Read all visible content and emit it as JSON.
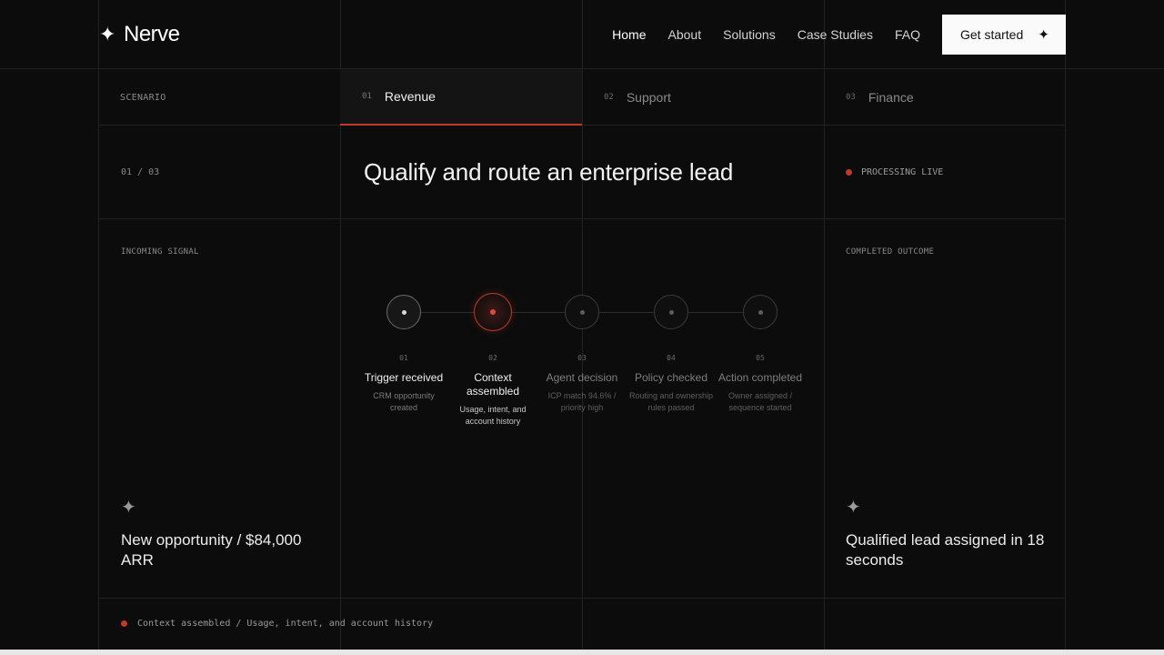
{
  "brand": {
    "name": "Nerve",
    "icon": "sparkle-icon"
  },
  "nav": {
    "items": [
      {
        "label": "Home",
        "active": true
      },
      {
        "label": "About",
        "active": false
      },
      {
        "label": "Solutions",
        "active": false
      },
      {
        "label": "Case Studies",
        "active": false
      },
      {
        "label": "FAQ",
        "active": false
      }
    ],
    "cta_label": "Get started"
  },
  "scenario": {
    "label": "SCENARIO",
    "tabs": [
      {
        "num": "01",
        "name": "Revenue",
        "active": true
      },
      {
        "num": "02",
        "name": "Support",
        "active": false
      },
      {
        "num": "03",
        "name": "Finance",
        "active": false
      }
    ]
  },
  "heading": {
    "counter": "01 / 03",
    "title": "Qualify and route an enterprise lead",
    "status": "PROCESSING LIVE"
  },
  "incoming": {
    "label": "INCOMING SIGNAL",
    "text": "New opportunity / $84,000 ARR"
  },
  "outcome": {
    "label": "COMPLETED OUTCOME",
    "text": "Qualified lead assigned in 18 seconds"
  },
  "steps": [
    {
      "num": "01",
      "title": "Trigger received",
      "desc": "CRM opportunity created",
      "state": "done"
    },
    {
      "num": "02",
      "title": "Context assembled",
      "desc": "Usage, intent, and account history",
      "state": "active"
    },
    {
      "num": "03",
      "title": "Agent decision",
      "desc": "ICP match 94.6% / priority high",
      "state": "pending"
    },
    {
      "num": "04",
      "title": "Policy checked",
      "desc": "Routing and ownership rules passed",
      "state": "pending"
    },
    {
      "num": "05",
      "title": "Action completed",
      "desc": "Owner assigned / sequence started",
      "state": "pending"
    }
  ],
  "footer": {
    "status": "Context assembled / Usage, intent, and account history"
  },
  "colors": {
    "accent": "#c0392b",
    "background": "#0c0c0c"
  }
}
